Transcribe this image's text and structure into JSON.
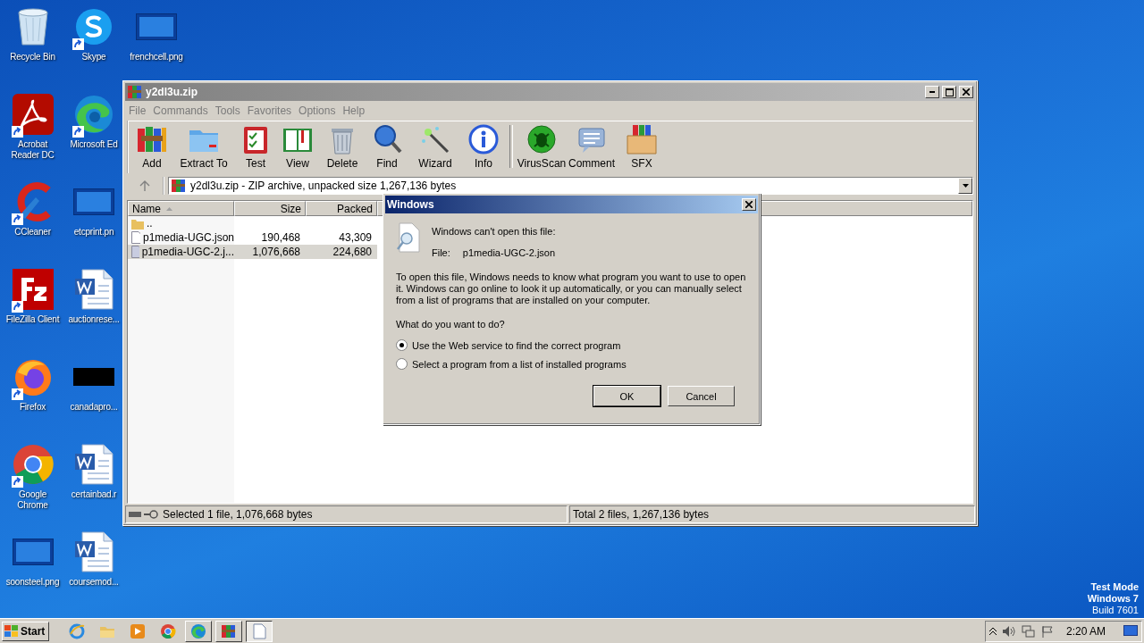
{
  "desktop_icons": [
    {
      "label": "Recycle Bin",
      "kind": "recycle",
      "shortcut": false
    },
    {
      "label": "Acrobat Reader DC",
      "kind": "acrobat",
      "shortcut": true
    },
    {
      "label": "CCleaner",
      "kind": "ccleaner",
      "shortcut": true
    },
    {
      "label": "FileZilla Client",
      "kind": "filezilla",
      "shortcut": true
    },
    {
      "label": "Firefox",
      "kind": "firefox",
      "shortcut": true
    },
    {
      "label": "Google Chrome",
      "kind": "chrome",
      "shortcut": true
    },
    {
      "label": "soonsteel.png",
      "kind": "image",
      "shortcut": false
    },
    {
      "label": "Skype",
      "kind": "skype",
      "shortcut": true
    },
    {
      "label": "Microsoft Ed",
      "kind": "edge",
      "shortcut": true
    },
    {
      "label": "etcprint.pn",
      "kind": "image",
      "shortcut": false
    },
    {
      "label": "auctionrese...",
      "kind": "word",
      "shortcut": false
    },
    {
      "label": "canadapro...",
      "kind": "blackimage",
      "shortcut": false
    },
    {
      "label": "certainbad.r",
      "kind": "word",
      "shortcut": false
    },
    {
      "label": "coursemod...",
      "kind": "word",
      "shortcut": false
    },
    {
      "label": "frenchcell.png",
      "kind": "image",
      "shortcut": false
    }
  ],
  "archiver": {
    "title": "y2dl3u.zip",
    "active": false,
    "menu": [
      "File",
      "Commands",
      "Tools",
      "Favorites",
      "Options",
      "Help"
    ],
    "toolbar": [
      {
        "label": "Add",
        "kind": "add"
      },
      {
        "label": "Extract To",
        "kind": "extract"
      },
      {
        "label": "Test",
        "kind": "test"
      },
      {
        "label": "View",
        "kind": "view"
      },
      {
        "label": "Delete",
        "kind": "delete"
      },
      {
        "label": "Find",
        "kind": "find"
      },
      {
        "label": "Wizard",
        "kind": "wizard"
      },
      {
        "label": "Info",
        "kind": "info"
      },
      {
        "label": "VirusScan",
        "kind": "virus"
      },
      {
        "label": "Comment",
        "kind": "comment"
      },
      {
        "label": "SFX",
        "kind": "sfx"
      }
    ],
    "path": "y2dl3u.zip - ZIP archive, unpacked size 1,267,136 bytes",
    "columns": [
      "Name",
      "Size",
      "Packed"
    ],
    "rows": [
      {
        "kind": "folder",
        "name": "..",
        "selected": false
      },
      {
        "kind": "file",
        "name": "p1media-UGC.json",
        "size": "190,468",
        "packed": "43,309",
        "selected": false
      },
      {
        "kind": "file",
        "name": "p1media-UGC-2.j...",
        "size": "1,076,668",
        "packed": "224,680",
        "selected": true
      }
    ],
    "status_left": "Selected 1 file, 1,076,668 bytes",
    "status_right": "Total 2 files, 1,267,136 bytes"
  },
  "dialog": {
    "title": "Windows",
    "active": true,
    "heading": "Windows can't open this file:",
    "file_label": "File:",
    "file_name": "p1media-UGC-2.json",
    "explanation": "To open this file, Windows needs to know what program you want to use to open it. Windows can go online to look it up automatically, or you can manually select from a list of programs that are installed on your computer.",
    "question": "What do you want to do?",
    "options": [
      {
        "label": "Use the Web service to find the correct program",
        "selected": true
      },
      {
        "label": "Select a program from a list of installed programs",
        "selected": false
      }
    ],
    "buttons": [
      {
        "label": "OK",
        "default": true
      },
      {
        "label": "Cancel",
        "default": false
      }
    ]
  },
  "desktop_notice": [
    "Test Mode",
    "Windows 7",
    "Build 7601"
  ],
  "taskbar": {
    "start": "Start",
    "items": [
      {
        "kind": "ie",
        "open": false,
        "active": false
      },
      {
        "kind": "explorer",
        "open": false,
        "active": false
      },
      {
        "kind": "media",
        "open": false,
        "active": false
      },
      {
        "kind": "chrome",
        "open": false,
        "active": false
      },
      {
        "kind": "edge",
        "open": true,
        "active": false
      },
      {
        "kind": "winrar",
        "open": true,
        "active": false
      },
      {
        "kind": "document",
        "open": true,
        "active": true
      }
    ],
    "clock": "2:20 AM"
  }
}
